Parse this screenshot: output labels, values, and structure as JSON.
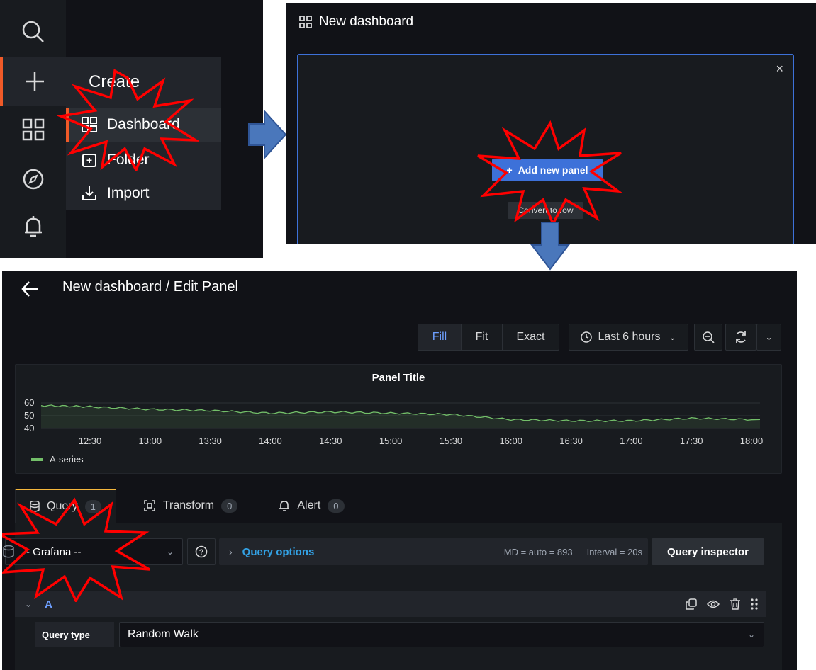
{
  "panel1": {
    "menu_title": "Create",
    "items": [
      {
        "label": "Dashboard",
        "icon": "dashboard-grid-icon"
      },
      {
        "label": "Folder",
        "icon": "folder-plus-icon"
      },
      {
        "label": "Import",
        "icon": "import-icon"
      }
    ],
    "rail_icons": [
      "search-icon",
      "plus-icon",
      "dashboards-icon",
      "explore-compass-icon",
      "alert-bell-icon"
    ]
  },
  "panel2": {
    "title": "New dashboard",
    "close": "×",
    "add_panel": "Add new panel",
    "convert_row": "Convert to row"
  },
  "panel3": {
    "breadcrumb": "New dashboard / Edit Panel",
    "view_modes": [
      "Fill",
      "Fit",
      "Exact"
    ],
    "time_range": "Last 6 hours",
    "chart_title": "Panel Title",
    "tabs": [
      {
        "label": "Query",
        "count": "1"
      },
      {
        "label": "Transform",
        "count": "0"
      },
      {
        "label": "Alert",
        "count": "0"
      }
    ],
    "datasource": "-- Grafana --",
    "query_options": "Query options",
    "md": "MD = auto = 893",
    "interval": "Interval = 20s",
    "query_inspector": "Query inspector",
    "query_name": "A",
    "query_type_label": "Query type",
    "query_type_value": "Random Walk"
  },
  "colors": {
    "accent_orange": "#f05a28",
    "primary_blue": "#3d71d9",
    "series_green": "#73bf69",
    "link_blue": "#33a2e5",
    "highlight_red": "#ff0000"
  },
  "chart_data": {
    "type": "line",
    "title": "Panel Title",
    "x": [
      "12:30",
      "13:00",
      "13:30",
      "14:00",
      "14:30",
      "15:00",
      "15:30",
      "16:00",
      "16:30",
      "17:00",
      "17:30",
      "18:00"
    ],
    "series": [
      {
        "name": "A-series",
        "values": [
          57,
          55,
          54,
          52,
          53,
          52,
          51,
          47,
          46,
          46,
          48,
          47
        ]
      }
    ],
    "y_ticks": [
      "40",
      "50",
      "60"
    ],
    "ylim": [
      40,
      60
    ],
    "grid": true,
    "legend": "bottom-left"
  }
}
